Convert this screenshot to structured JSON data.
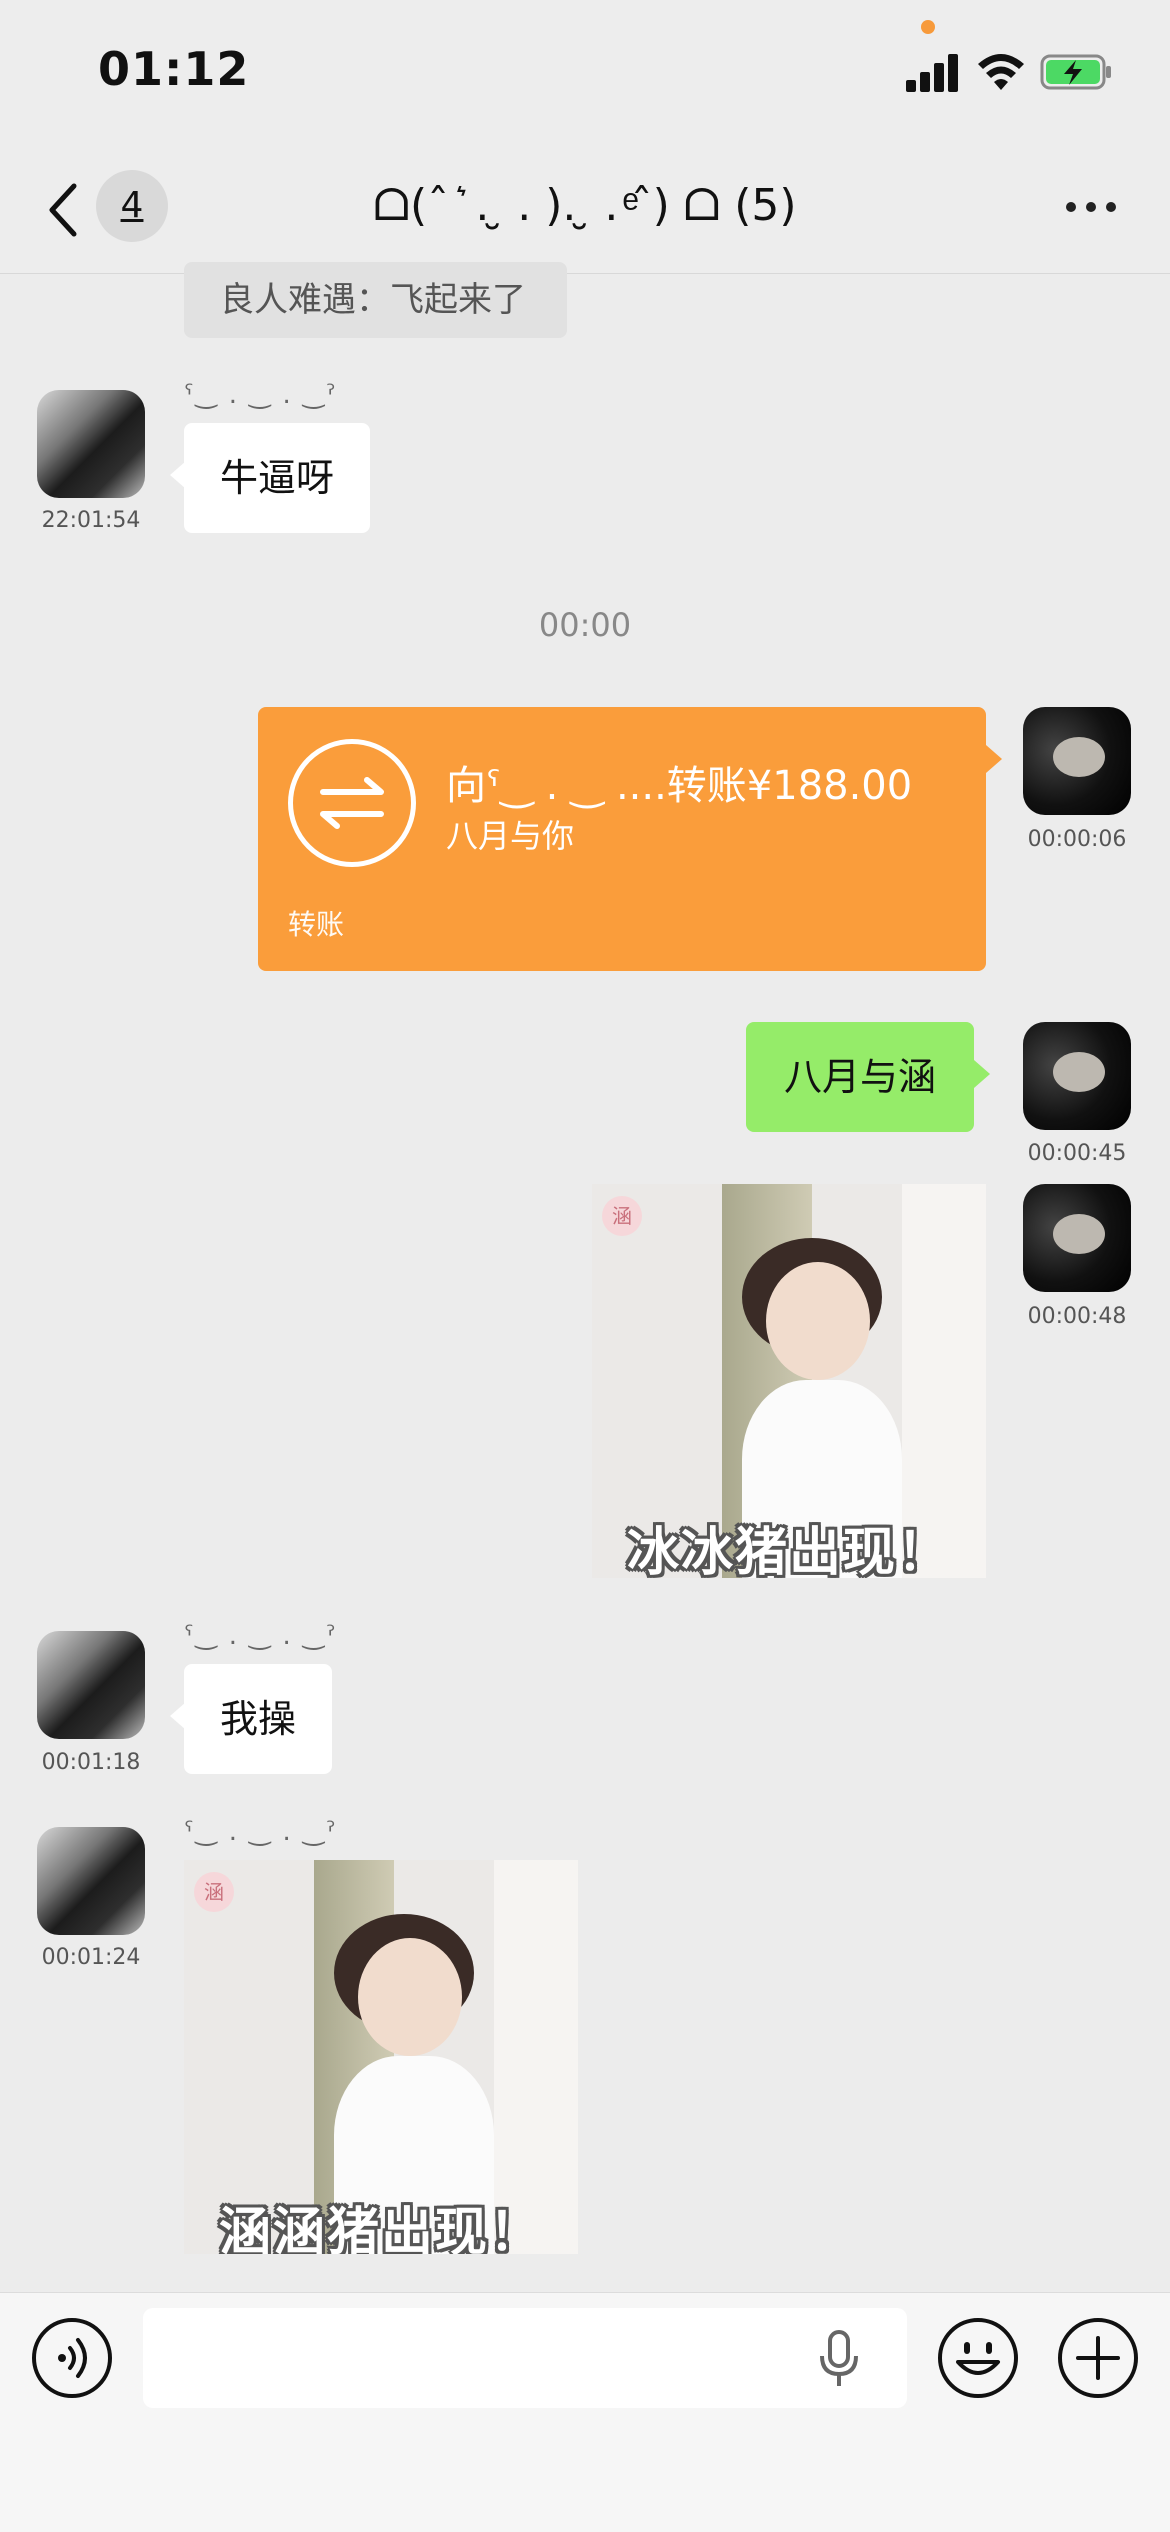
{
  "status_bar": {
    "time": "01:12",
    "battery_color": "#4cd964",
    "indicator_color": "#f79a3b"
  },
  "nav": {
    "unread_count": "4",
    "title": "ᗝ(ˆ ͛ . ̮ . ). ̮ . ͤˆ) ᗝ (5)",
    "back_icon": "chevron-left-icon",
    "more_icon": "more-dots-icon"
  },
  "messages": {
    "quote_text": "良人难遇：飞起来了",
    "msg1": {
      "sender": "ˁ‿ . ‿ . ‿ˀ",
      "text": "牛逼呀",
      "time": "22:01:54"
    },
    "center_time": "00:00",
    "transfer": {
      "amount_text": "向ˁ‿ . ‿ ....转账¥188.00",
      "note": "八月与你",
      "label": "转账",
      "time": "00:00:06",
      "color": "#fa9d3b"
    },
    "msg2": {
      "text": "八月与涵",
      "time": "00:00:45",
      "color": "#95ec69"
    },
    "sticker1": {
      "caption": "冰冰猪出现！",
      "time": "00:00:48",
      "stamp": "涵"
    },
    "msg3": {
      "sender": "ˁ‿ . ‿ . ‿ˀ",
      "text": "我操",
      "time": "00:01:18"
    },
    "sticker2": {
      "sender": "ˁ‿ . ‿ . ‿ˀ",
      "caption": "涵涵猪出现！",
      "time": "00:01:24",
      "stamp": "涵"
    }
  },
  "input_bar": {
    "placeholder": "",
    "icons": [
      "voice-icon",
      "mic-icon",
      "emoji-icon",
      "plus-icon"
    ]
  }
}
